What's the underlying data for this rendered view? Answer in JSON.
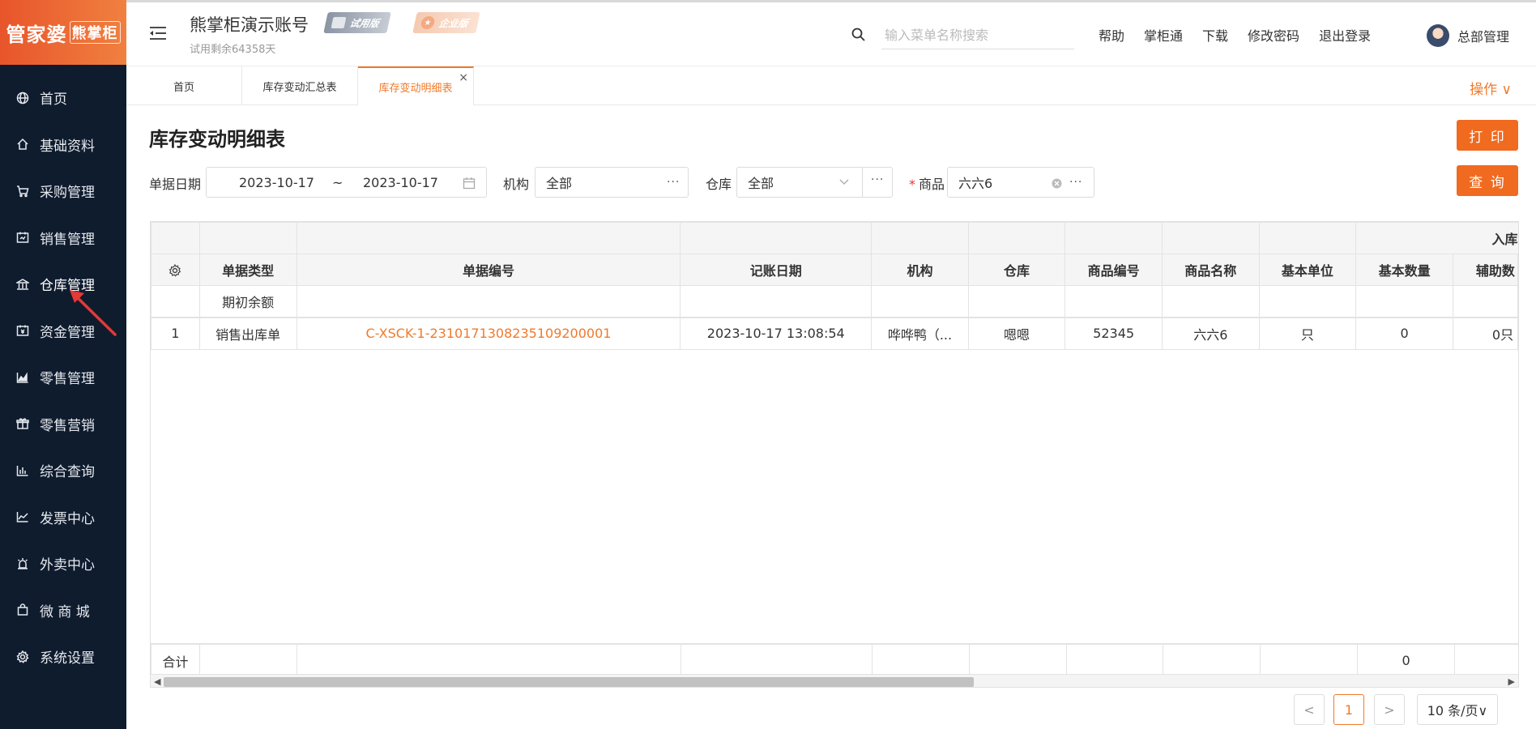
{
  "sidebar": {
    "logo_main": "管家婆",
    "logo_sub": "熊掌柜",
    "items": [
      {
        "label": "首页",
        "icon": "globe-icon"
      },
      {
        "label": "基础资料",
        "icon": "home-icon"
      },
      {
        "label": "采购管理",
        "icon": "cart-icon"
      },
      {
        "label": "销售管理",
        "icon": "sales-icon"
      },
      {
        "label": "仓库管理",
        "icon": "warehouse-icon",
        "active": true
      },
      {
        "label": "资金管理",
        "icon": "funds-icon"
      },
      {
        "label": "零售管理",
        "icon": "retail-chart-icon"
      },
      {
        "label": "零售营销",
        "icon": "gift-icon"
      },
      {
        "label": "综合查询",
        "icon": "bar-chart-icon"
      },
      {
        "label": "发票中心",
        "icon": "invoice-icon"
      },
      {
        "label": "外卖中心",
        "icon": "alarm-icon"
      },
      {
        "label": "微 商 城",
        "icon": "bag-icon"
      },
      {
        "label": "系统设置",
        "icon": "gear-icon"
      }
    ]
  },
  "header": {
    "account_name": "熊掌柜演示账号",
    "trial_text": "试用剩余64358天",
    "badge_trial": "试用版",
    "badge_enterprise": "企业版",
    "search_placeholder": "输入菜单名称搜索",
    "links": [
      "帮助",
      "掌柜通",
      "下载",
      "修改密码",
      "退出登录"
    ],
    "user_name": "总部管理"
  },
  "tabs": {
    "home": "首页",
    "summary": "库存变动汇总表",
    "detail": "库存变动明细表",
    "close": "×",
    "operations": "操作 ∨"
  },
  "page": {
    "title": "库存变动明细表",
    "print_label": "打 印",
    "query_label": "查 询"
  },
  "filters": {
    "date_label": "单据日期",
    "date_from": "2023-10-17",
    "date_sep": "~",
    "date_to": "2023-10-17",
    "org_label": "机构",
    "org_value": "全部",
    "warehouse_label": "仓库",
    "warehouse_value": "全部",
    "goods_req": "*",
    "goods_label": "商品",
    "goods_value": "六六6",
    "more": "···"
  },
  "table": {
    "group_header": "入库",
    "columns": [
      "单据类型",
      "单据编号",
      "记账日期",
      "机构",
      "仓库",
      "商品编号",
      "商品名称",
      "基本单位",
      "基本数量",
      "辅助数"
    ],
    "opening_row_label": "期初余额",
    "rows": [
      {
        "index": "1",
        "type": "销售出库单",
        "code": "C-XSCK-1-2310171308235109200001",
        "date": "2023-10-17 13:08:54",
        "org": "哗哗鸭（...",
        "warehouse": "嗯嗯",
        "goods_code": "52345",
        "goods_name": "六六6",
        "unit": "只",
        "qty": "0",
        "aux_qty": "0只"
      }
    ],
    "total_label": "合计",
    "total_qty": "0"
  },
  "pagination": {
    "prev": "<",
    "current": "1",
    "next": ">",
    "page_size": "10 条/页∨"
  },
  "colors": {
    "accent": "#f07a2b",
    "sidebar_bg": "#0f1c2e"
  }
}
